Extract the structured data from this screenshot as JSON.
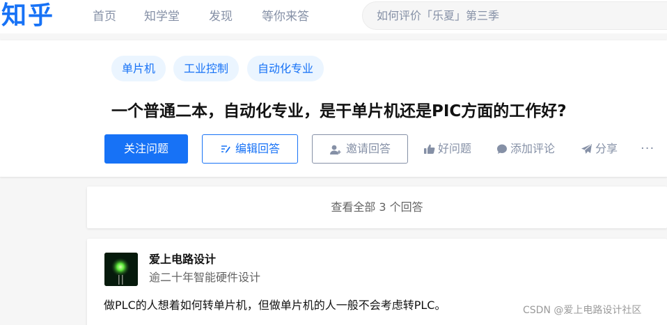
{
  "header": {
    "logo": "知乎",
    "nav": [
      "首页",
      "知学堂",
      "发现",
      "等你来答"
    ],
    "search_placeholder": "如何评价「乐夏」第三季"
  },
  "question": {
    "tags": [
      "单片机",
      "工业控制",
      "自动化专业"
    ],
    "title": "一个普通二本，自动化专业，是干单片机还是PIC方面的工作好?",
    "buttons": {
      "follow": "关注问题",
      "edit": "编辑回答",
      "invite": "邀请回答"
    },
    "actions": {
      "good_question": "好问题",
      "add_comment": "添加评论",
      "share": "分享",
      "more": "···"
    }
  },
  "view_all": "查看全部 3 个回答",
  "answer": {
    "author": "爱上电路设计",
    "headline": "逾二十年智能硬件设计",
    "content": "做PLC的人想着如何转单片机，但做单片机的人一般不会考虑转PLC。"
  },
  "watermark": "CSDN @爱上电路设计社区",
  "colors": {
    "brand": "#1772f6",
    "tag_bg": "#ebf5ff",
    "muted": "#8590a6",
    "page_bg": "#f6f6f6"
  },
  "icons": {
    "edit": "edit-icon",
    "invite": "add-user-icon",
    "good_question": "thumb-up-icon",
    "add_comment": "comment-bubble-icon",
    "share": "paper-plane-icon"
  }
}
